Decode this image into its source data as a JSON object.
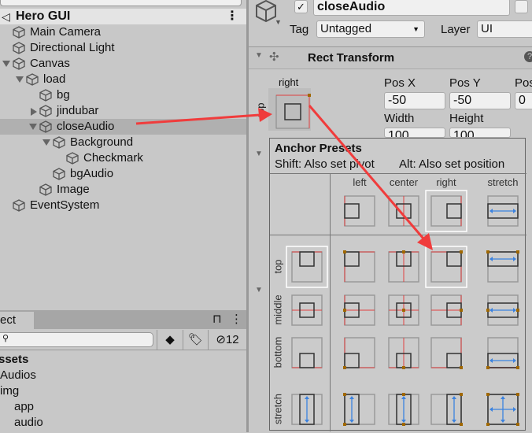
{
  "hierarchy": {
    "scene": "Hero GUI",
    "menu_icon": "kebab-icon",
    "items": [
      {
        "label": "Main Camera",
        "depth": 0,
        "expand": ""
      },
      {
        "label": "Directional Light",
        "depth": 0,
        "expand": ""
      },
      {
        "label": "Canvas",
        "depth": 0,
        "expand": "down"
      },
      {
        "label": "load",
        "depth": 1,
        "expand": "down"
      },
      {
        "label": "bg",
        "depth": 2,
        "expand": ""
      },
      {
        "label": "jindubar",
        "depth": 2,
        "expand": "right"
      },
      {
        "label": "closeAudio",
        "depth": 2,
        "expand": "down",
        "selected": true
      },
      {
        "label": "Background",
        "depth": 3,
        "expand": "down"
      },
      {
        "label": "Checkmark",
        "depth": 4,
        "expand": ""
      },
      {
        "label": "bgAudio",
        "depth": 3,
        "expand": ""
      },
      {
        "label": "Image",
        "depth": 2,
        "expand": ""
      },
      {
        "label": "EventSystem",
        "depth": 0,
        "expand": ""
      }
    ]
  },
  "project": {
    "tab": "ect",
    "hidden_count": "12",
    "assets": [
      {
        "label": "ssets",
        "bold": true
      },
      {
        "label": "Audios"
      },
      {
        "label": "img"
      },
      {
        "label": "app"
      },
      {
        "label": "audio"
      }
    ]
  },
  "inspector": {
    "object_name": "closeAudio",
    "active": true,
    "tag_label": "Tag",
    "tag_value": "Untagged",
    "layer_label": "Layer",
    "layer_value": "UI",
    "component": "Rect Transform",
    "anchor_label": "right",
    "anchor_side_label": "top",
    "pos_x_label": "Pos X",
    "pos_x": "-50",
    "pos_y_label": "Pos Y",
    "pos_y": "-50",
    "pos_z_label": "Pos",
    "pos_z": "0",
    "width_label": "Width",
    "width": "100",
    "height_label": "Height",
    "height": "100"
  },
  "anchor_presets": {
    "title": "Anchor Presets",
    "hint_shift": "Shift: Also set pivot",
    "hint_alt": "Alt: Also set position",
    "columns": [
      "left",
      "center",
      "right",
      "stretch"
    ],
    "rows": [
      "top",
      "middle",
      "bottom",
      "stretch"
    ],
    "selected": "top-right"
  },
  "colors": {
    "annotation_arrow": "#f03c3c",
    "anchor_line": "#e04040",
    "anchor_dot": "#a06800",
    "stretch_arrow": "#3b82e0",
    "selection": "#b0b0b0"
  }
}
